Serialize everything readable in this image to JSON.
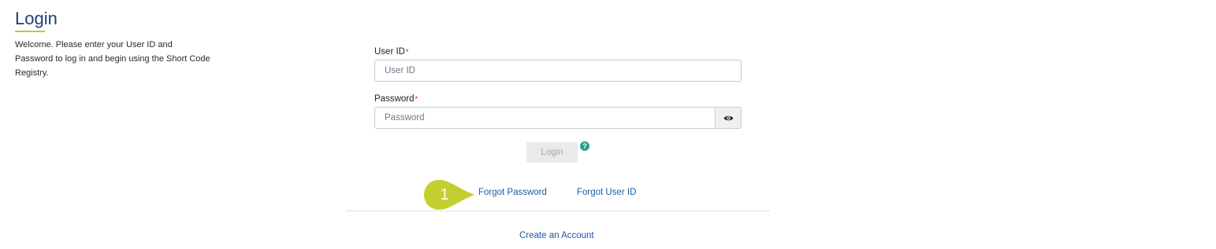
{
  "intro": {
    "title": "Login",
    "welcome": "Welcome. Please enter your User ID and Password to log in and begin using the Short Code Registry."
  },
  "form": {
    "user_id": {
      "label": "User ID",
      "required_mark": "*",
      "placeholder": "User ID",
      "value": ""
    },
    "password": {
      "label": "Password",
      "required_mark": "*",
      "placeholder": "Password",
      "value": ""
    },
    "show_password_icon": "eye-icon",
    "login_label": "Login",
    "help_icon": "question-icon",
    "help_glyph": "?"
  },
  "links": {
    "forgot_password": "Forgot Password",
    "forgot_user_id": "Forgot User ID",
    "create_account": "Create an Account"
  },
  "callout": {
    "number": "1"
  },
  "colors": {
    "title": "#1d3f73",
    "accent_underline": "#b9c93a",
    "link": "#1f5aa8",
    "required": "#d0021b",
    "callout": "#c3cf2f",
    "help": "#2a9d8f"
  }
}
